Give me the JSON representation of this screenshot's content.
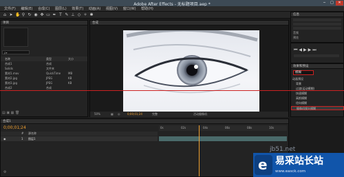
{
  "window": {
    "title": "Adobe After Effects - 无标题项目.aep *",
    "controls": [
      "─",
      "□",
      "✕"
    ]
  },
  "menu": [
    "文件(F)",
    "编辑(E)",
    "合成(C)",
    "图层(L)",
    "效果(T)",
    "动画(A)",
    "视图(V)",
    "窗口(W)",
    "帮助(H)"
  ],
  "project": {
    "tab": "项目",
    "search_placeholder": "ρ▾",
    "columns": {
      "name": "名称",
      "type": "类型",
      "size": "大小"
    },
    "items": [
      {
        "name": "合成1",
        "type": "合成",
        "size": ""
      },
      {
        "name": "Solids",
        "type": "文件夹",
        "size": ""
      },
      {
        "name": "素材1.mov",
        "type": "QuickTime",
        "size": "MB"
      },
      {
        "name": "素材2.jpg",
        "type": "JPEG",
        "size": "KB"
      },
      {
        "name": "素材3.jpg",
        "type": "JPEG",
        "size": "KB"
      },
      {
        "name": "合成2",
        "type": "合成",
        "size": ""
      }
    ]
  },
  "viewer": {
    "tab": "合成",
    "zoom": "50%",
    "timecode": "0;00;01;24",
    "quality": "完整",
    "view": "活动摄像机"
  },
  "right_panel": {
    "info_tab": "信息",
    "audio_tab": "音频",
    "preview_tab": "预览",
    "effects_tab": "效果和预设",
    "search_value": "模糊",
    "tree": [
      {
        "label": "动画预设",
        "level": 0
      },
      {
        "label": "背景",
        "level": 1
      },
      {
        "label": "过渡(运动模糊)",
        "level": 1
      },
      {
        "label": "快速模糊",
        "level": 1
      },
      {
        "label": "高斯模糊",
        "level": 1
      },
      {
        "label": "径向模糊",
        "level": 1
      },
      {
        "label": "摄像机镜头模糊",
        "level": 1,
        "selected": true
      }
    ]
  },
  "timeline": {
    "tab": "合成1",
    "timecode": "0;00;01;24",
    "layer_header": {
      "num": "#",
      "name": "源名称"
    },
    "layer": {
      "num": "1",
      "name": "图层1"
    },
    "ruler": [
      "0s",
      "02s",
      "04s",
      "06s",
      "08s",
      "10s"
    ],
    "playhead_fraction": 0.31
  },
  "overlay": {
    "watermark": "jb51.net",
    "brand": "易采站长站",
    "brand_url": "www.easck.com"
  },
  "colors": {
    "accent": "#f0a030",
    "red_marker": "#cc2222",
    "brand_blue": "#1155aa"
  }
}
